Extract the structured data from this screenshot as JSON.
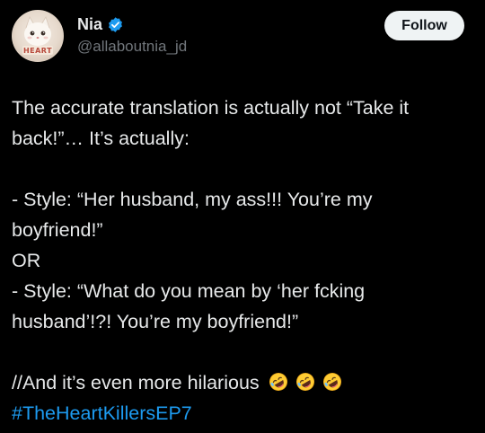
{
  "author": {
    "display_name": "Nia",
    "handle": "@allaboutnia_jd",
    "avatar_text": "HEART",
    "verified": true
  },
  "follow_label": "Follow",
  "post": {
    "lines": [
      "The accurate translation is actually not “Take it",
      "back!”… It’s actually:",
      "",
      "- Style: “Her husband, my ass!!! You’re my",
      "boyfriend!”",
      "OR",
      "- Style: “What do you mean by ‘her fcking",
      "husband’!?! You’re my boyfriend!”",
      "",
      "//And it’s even more hilarious"
    ],
    "emojis": [
      "rolling-on-floor-laughing",
      "rolling-on-floor-laughing",
      "rolling-on-floor-laughing"
    ],
    "hashtag": "#TheHeartKillersEP7"
  },
  "colors": {
    "background": "#000000",
    "text": "#e7e9ea",
    "secondary_text": "#71767b",
    "accent": "#1d9bf0",
    "follow_button_bg": "#eff3f4"
  }
}
